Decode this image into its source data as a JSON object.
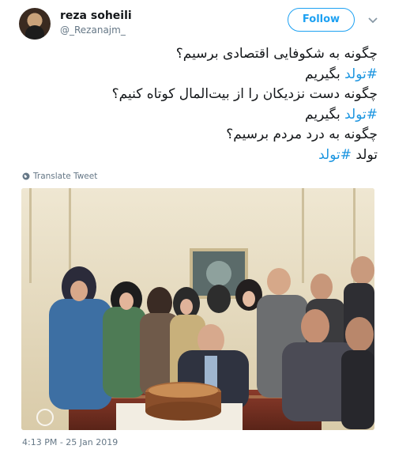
{
  "user": {
    "display_name": "reza soheili",
    "handle": "@_Rezanajm_"
  },
  "follow_label": "Follow",
  "tweet": {
    "lines": [
      {
        "text": "چگونه به شکوفایی اقتصادی برسیم؟",
        "hashtag": "",
        "suffix": ""
      },
      {
        "text": "",
        "hashtag": "#تولد",
        "suffix": " بگیریم"
      },
      {
        "text": "چگونه دست نزدیکان را از بیت‌المال کوتاه کنیم؟",
        "hashtag": "",
        "suffix": ""
      },
      {
        "text": "",
        "hashtag": "#تولد",
        "suffix": " بگیریم"
      },
      {
        "text": "چگونه به درد مردم برسیم؟",
        "hashtag": "",
        "suffix": ""
      },
      {
        "text": "تولد ",
        "hashtag": "#تولد",
        "suffix": ""
      }
    ]
  },
  "translate_label": "Translate Tweet",
  "timestamp": "4:13 PM - 25 Jan 2019",
  "icons": {
    "caret": "chevron-down-icon",
    "globe": "globe-icon"
  },
  "colors": {
    "accent": "#1da1f2",
    "hashtag": "#1b95e0",
    "secondary_text": "#657786"
  }
}
